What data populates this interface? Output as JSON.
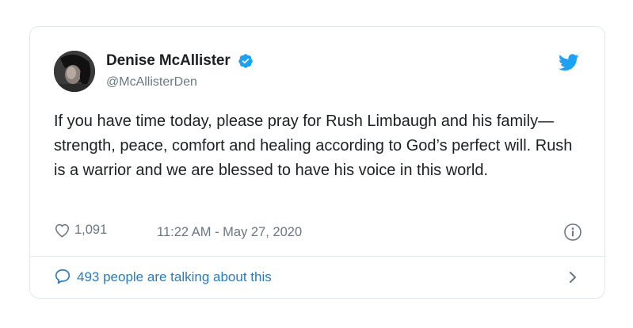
{
  "tweet": {
    "author": {
      "display_name": "Denise McAllister",
      "handle": "@McAllisterDen",
      "verified": true
    },
    "text": "If you have time today, please pray for Rush Limbaugh and his family—strength, peace, comfort and healing according to God’s perfect will. Rush is a warrior and we are blessed to have his voice in this world.",
    "likes": "1,091",
    "timestamp": "11:22 AM - May 27, 2020",
    "conversation_label": "493 people are talking about this"
  },
  "icons": {
    "brand": "twitter-bird-icon",
    "verified": "verified-badge-icon",
    "like": "heart-icon",
    "info": "info-icon",
    "conversation": "speech-bubble-icon",
    "chevron": "chevron-right-icon"
  },
  "colors": {
    "text": "#1c2022",
    "secondary": "#697882",
    "link": "#2b7bb9",
    "brand": "#1da1f2",
    "border": "#e1e8ed"
  }
}
